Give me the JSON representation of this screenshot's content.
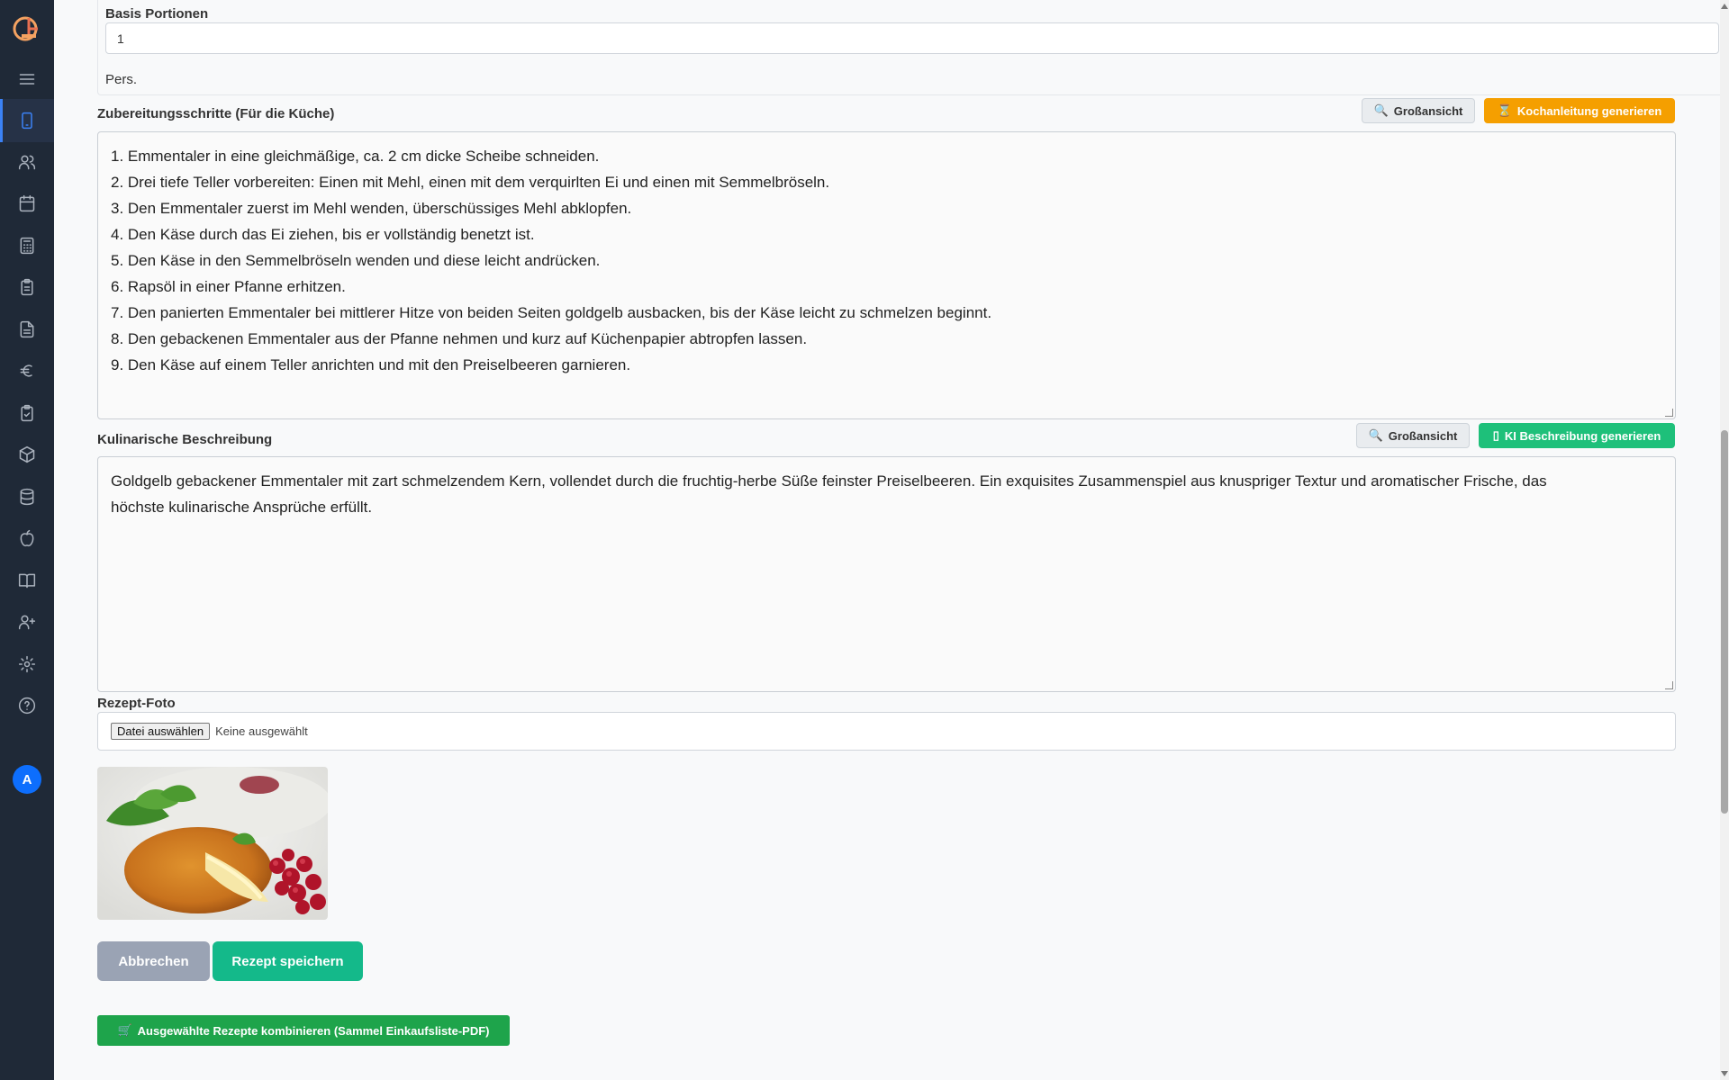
{
  "portions": {
    "label": "Basis Portionen",
    "value": "1",
    "unit": "Pers."
  },
  "steps": {
    "label": "Zubereitungsschritte (Für die Küche)",
    "zoom_button": "Großansicht",
    "generate_button": "Kochanleitung generieren",
    "lines": [
      "1. Emmentaler in eine gleichmäßige, ca. 2 cm dicke Scheibe schneiden.",
      "2. Drei tiefe Teller vorbereiten: Einen mit Mehl, einen mit dem verquirlten Ei und einen mit Semmelbröseln.",
      "3. Den Emmentaler zuerst im Mehl wenden, überschüssiges Mehl abklopfen.",
      "4. Den Käse durch das Ei ziehen, bis er vollständig benetzt ist.",
      "5. Den Käse in den Semmelbröseln wenden und diese leicht andrücken.",
      "6. Rapsöl in einer Pfanne erhitzen.",
      "7. Den panierten Emmentaler bei mittlerer Hitze von beiden Seiten goldgelb ausbacken, bis der Käse leicht zu schmelzen beginnt.",
      "8. Den gebackenen Emmentaler aus der Pfanne nehmen und kurz auf Küchenpapier abtropfen lassen.",
      "9. Den Käse auf einem Teller anrichten und mit den Preiselbeeren garnieren."
    ]
  },
  "description": {
    "label": "Kulinarische Beschreibung",
    "zoom_button": "Großansicht",
    "generate_button": "KI Beschreibung generieren",
    "lines": [
      "Goldgelb gebackener Emmentaler mit zart schmelzendem Kern, vollendet durch die fruchtig-herbe Süße feinster Preiselbeeren. Ein exquisites Zusammenspiel aus knuspriger Textur und aromatischer Frische, das",
      "höchste kulinarische Ansprüche erfüllt."
    ]
  },
  "photo": {
    "label": "Rezept-Foto",
    "file_button": "Datei auswählen",
    "file_status": "Keine ausgewählt"
  },
  "actions": {
    "cancel": "Abbrechen",
    "save": "Rezept speichern",
    "combine": "Ausgewählte Rezepte kombinieren (Sammel Einkaufsliste-PDF)"
  },
  "user": {
    "avatar_initial": "A"
  },
  "colors": {
    "sidebar": "#1f2937",
    "accent": "#3b82f6",
    "orange": "#f59f00",
    "green": "#1ec07a",
    "teal": "#14b98a",
    "dark_green": "#1ea44b",
    "slate": "#9aa3b4"
  },
  "icons": {
    "sidebar": [
      "logo-icon",
      "menu-icon",
      "phone-icon",
      "users-icon",
      "calendar-icon",
      "calculator-icon",
      "clipboard-icon",
      "document-icon",
      "euro-icon",
      "checklist-icon",
      "box-icon",
      "database-icon",
      "apple-icon",
      "book-icon",
      "user-plus-icon",
      "settings-icon",
      "help-icon"
    ],
    "zoom": "magnifier-icon",
    "hourglass": "hourglass-icon",
    "cart": "cart-icon"
  }
}
